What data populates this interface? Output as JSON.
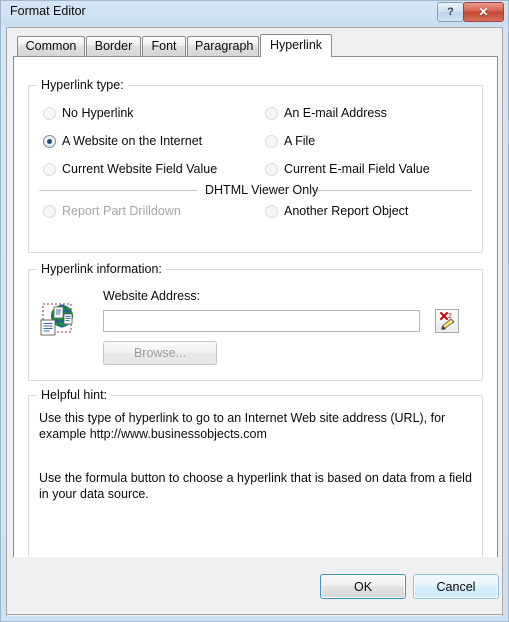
{
  "window": {
    "title": "Format Editor",
    "ghost_title": "",
    "help_button": "?",
    "close_button": "✕"
  },
  "tabs": [
    {
      "label": "Common",
      "active": false
    },
    {
      "label": "Border",
      "active": false
    },
    {
      "label": "Font",
      "active": false
    },
    {
      "label": "Paragraph",
      "active": false
    },
    {
      "label": "Hyperlink",
      "active": true
    }
  ],
  "hyperlink_type": {
    "legend": "Hyperlink type:",
    "options_left": [
      {
        "label": "No Hyperlink",
        "selected": false,
        "disabled": false
      },
      {
        "label": "A Website on the Internet",
        "selected": true,
        "disabled": false
      },
      {
        "label": "Current Website Field Value",
        "selected": false,
        "disabled": false
      }
    ],
    "options_right": [
      {
        "label": "An E-mail Address",
        "selected": false,
        "disabled": false
      },
      {
        "label": "A File",
        "selected": false,
        "disabled": false
      },
      {
        "label": "Current E-mail Field Value",
        "selected": false,
        "disabled": false
      }
    ],
    "dhtml_heading": "DHTML Viewer Only",
    "dhtml_options": [
      {
        "label": "Report Part Drilldown",
        "selected": false,
        "disabled": true
      },
      {
        "label": "Another Report Object",
        "selected": false,
        "disabled": false
      }
    ]
  },
  "hyperlink_information": {
    "legend": "Hyperlink information:",
    "address_label": "Website Address:",
    "address_value": "",
    "address_placeholder": "",
    "browse_label": "Browse...",
    "formula_button_title": "x-2",
    "globe_icon": "globe-document-icon"
  },
  "helpful_hint": {
    "legend": "Helpful hint:",
    "paragraph_1": "Use this type of hyperlink to go to an Internet Web site address (URL), for example http://www.businessobjects.com",
    "paragraph_2": "Use the formula button to choose a hyperlink that is based on data from a field in your data source."
  },
  "footer": {
    "ok_label": "OK",
    "cancel_label": "Cancel"
  },
  "colors": {
    "titlebar": "#cfe2f4",
    "close_button": "#c24530",
    "accent_focus": "#3c93c2",
    "dialog_face": "#f0f0f0",
    "radio_dot": "#1d4f7c"
  }
}
